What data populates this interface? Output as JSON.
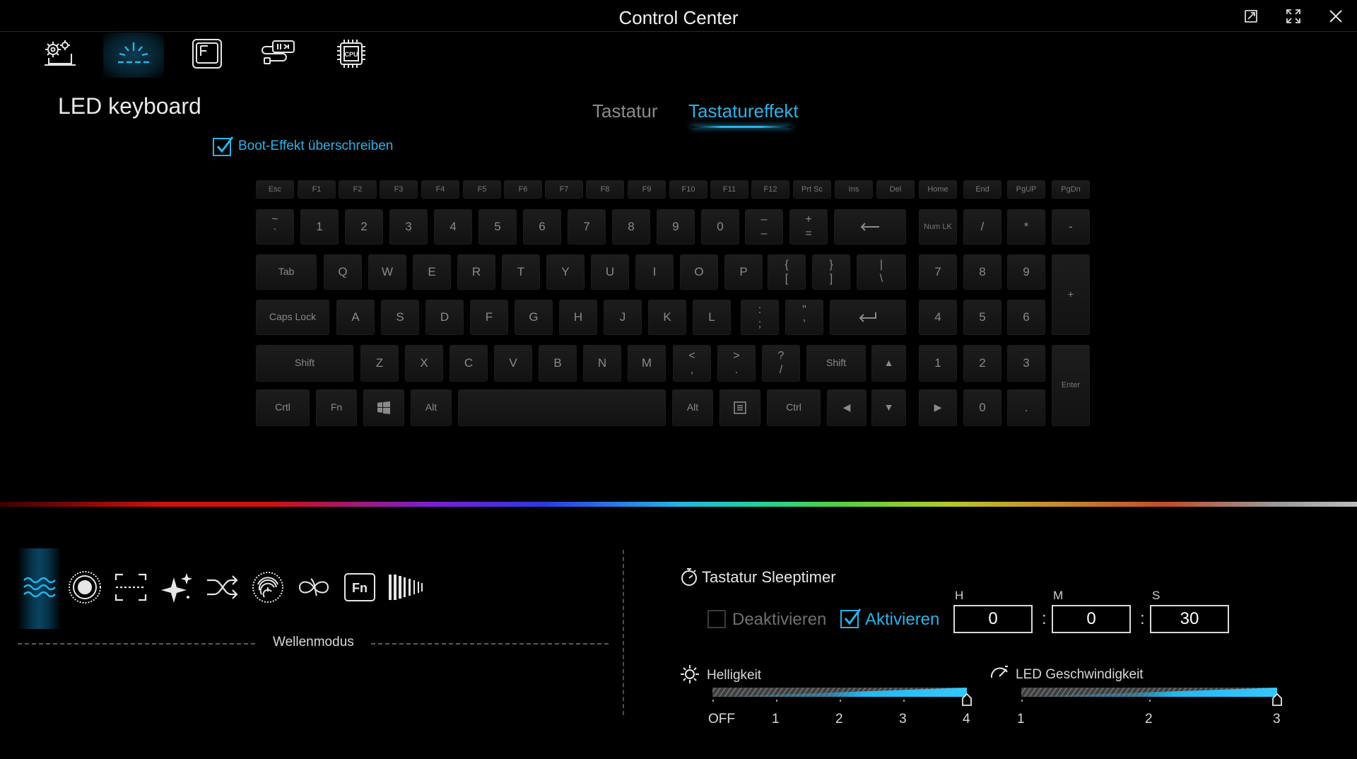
{
  "window": {
    "title": "Control Center"
  },
  "section_title": "LED keyboard",
  "tabs": [
    {
      "label": "Tastatur",
      "active": false
    },
    {
      "label": "Tastatureffekt",
      "active": true
    }
  ],
  "boot_override": {
    "label": "Boot-Effekt überschreiben",
    "checked": true
  },
  "nav_icons": [
    "system-settings-icon",
    "led-keyboard-icon",
    "fn-key-icon",
    "usb-power-icon",
    "cpu-icon"
  ],
  "keyboard": {
    "fn_row": [
      "Esc",
      "F1",
      "F2",
      "F3",
      "F4",
      "F5",
      "F6",
      "F7",
      "F8",
      "F9",
      "F10",
      "F11",
      "F12",
      "Prt Sc",
      "Ins",
      "Del",
      "Home",
      "End",
      "PgUP",
      "PgDn"
    ],
    "num_row_tops": [
      "~",
      "1",
      "2",
      "3",
      "4",
      "5",
      "6",
      "7",
      "8",
      "9",
      "0",
      "–",
      "+"
    ],
    "num_row_bottoms": [
      "`",
      "",
      "",
      "",
      "",
      "",
      "",
      "",
      "",
      "",
      "",
      "–",
      "="
    ],
    "qwerty_row": [
      "Tab",
      "Q",
      "W",
      "E",
      "R",
      "T",
      "Y",
      "U",
      "I",
      "O",
      "P"
    ],
    "qwerty_brackets": [
      [
        "{",
        "["
      ],
      [
        "}",
        "]"
      ],
      [
        "|",
        "\\"
      ]
    ],
    "home_row": [
      "Caps Lock",
      "A",
      "S",
      "D",
      "F",
      "G",
      "H",
      "J",
      "K",
      "L"
    ],
    "home_punct": [
      [
        ":",
        ";"
      ],
      [
        "\"",
        "'"
      ]
    ],
    "shift_row": [
      "Shift",
      "Z",
      "X",
      "C",
      "V",
      "B",
      "N",
      "M"
    ],
    "shift_punct": [
      [
        "<",
        ","
      ],
      [
        ">",
        "."
      ],
      [
        "?",
        "/"
      ]
    ],
    "shift_right": "Shift",
    "bottom_row": {
      "ctrl": "Crtl",
      "fn": "Fn",
      "alt": "Alt",
      "alt_r": "Alt",
      "ctrl_r": "Ctrl"
    },
    "numpad": {
      "row1": [
        "Num LK",
        "/",
        "*",
        "-"
      ],
      "row2": [
        "7",
        "8",
        "9",
        "+"
      ],
      "row3": [
        "4",
        "5",
        "6"
      ],
      "row4": [
        "1",
        "2",
        "3",
        "Enter"
      ],
      "row5": [
        "0",
        "."
      ]
    },
    "arrows": {
      "up": "▲",
      "left": "◀",
      "down": "▼",
      "right": "▶"
    }
  },
  "effects": {
    "icons": [
      "wave-icon",
      "ripple-icon",
      "scan-icon",
      "sparkle-icon",
      "shuffle-icon",
      "fingerprint-icon",
      "infinity-icon",
      "fn-icon",
      "equalizer-bars-icon"
    ],
    "active_index": 0,
    "mode_label": "Wellenmodus"
  },
  "sleeptimer": {
    "title": "Tastatur Sleeptimer",
    "deactivate_label": "Deaktivieren",
    "activate_label": "Aktivieren",
    "activated": true,
    "headers": {
      "h": "H",
      "m": "M",
      "s": "S"
    },
    "values": {
      "h": "0",
      "m": "0",
      "s": "30"
    },
    "separator": ":"
  },
  "brightness": {
    "label": "Helligkeit",
    "ticks": [
      "OFF",
      "1",
      "2",
      "3",
      "4"
    ],
    "value": 4
  },
  "led_speed": {
    "label": "LED Geschwindigkeit",
    "ticks": [
      "1",
      "2",
      "3"
    ],
    "value": 3
  },
  "colors": {
    "accent": "#2cb2e6",
    "background": "#000000",
    "key": "#161616"
  }
}
